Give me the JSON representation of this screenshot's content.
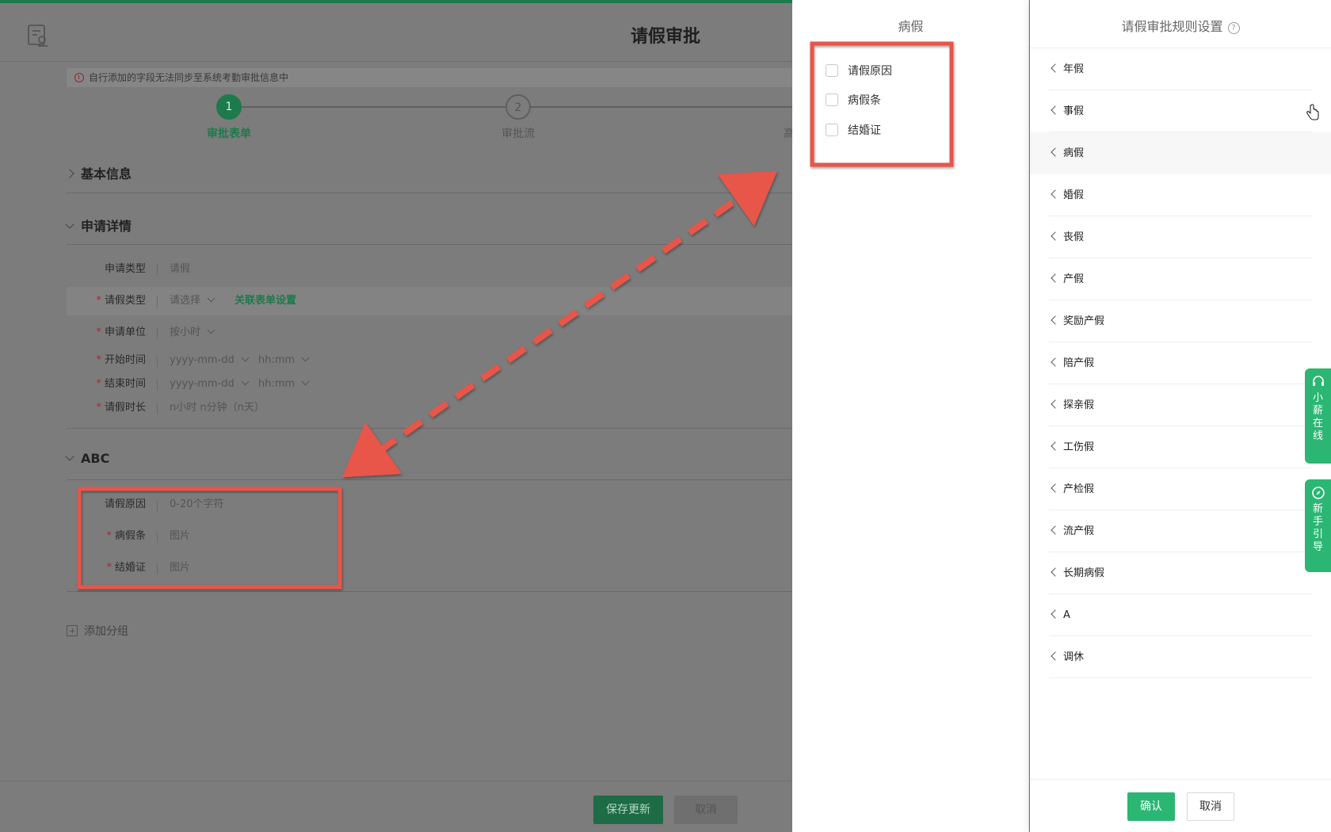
{
  "page": {
    "title": "请假审批",
    "notice": "自行添加的字段无法同步至系统考勤审批信息中"
  },
  "steps": [
    {
      "num": "1",
      "label": "审批表单"
    },
    {
      "num": "2",
      "label": "审批流"
    },
    {
      "label": "高"
    }
  ],
  "sections": {
    "basic": "基本信息",
    "detail": "申请详情",
    "abc": "ABC"
  },
  "detail_rows": [
    {
      "label": "申请类型",
      "value": "请假"
    },
    {
      "label": "请假类型",
      "value": "请选择",
      "link": "关联表单设置"
    },
    {
      "label": "申请单位",
      "value": "按小时"
    },
    {
      "label": "开始时间",
      "value": "yyyy-mm-dd",
      "value2": "hh:mm"
    },
    {
      "label": "结束时间",
      "value": "yyyy-mm-dd",
      "value2": "hh:mm"
    },
    {
      "label": "请假时长",
      "value": "n小时 n分钟（n天）"
    }
  ],
  "abc_rows": [
    {
      "label": "请假原因",
      "value": "0-20个字符"
    },
    {
      "label": "病假条",
      "value": "图片"
    },
    {
      "label": "结婚证",
      "value": "图片"
    }
  ],
  "add_group": "添加分组",
  "footer": {
    "save": "保存更新",
    "cancel": "取消"
  },
  "mid_panel": {
    "title": "病假",
    "options": [
      "请假原因",
      "病假条",
      "结婚证"
    ]
  },
  "right_panel": {
    "title": "请假审批规则设置",
    "help": "?",
    "items": [
      "年假",
      "事假",
      "病假",
      "婚假",
      "丧假",
      "产假",
      "奖励产假",
      "陪产假",
      "探亲假",
      "工伤假",
      "产检假",
      "流产假",
      "长期病假",
      "A",
      "调休"
    ],
    "confirm": "确认",
    "cancel": "取消"
  },
  "float_buttons": {
    "online": "小薪在线",
    "guide": "新手引导"
  },
  "colors": {
    "brand_green": "#2bb673",
    "annotation_red": "#e8554a"
  }
}
